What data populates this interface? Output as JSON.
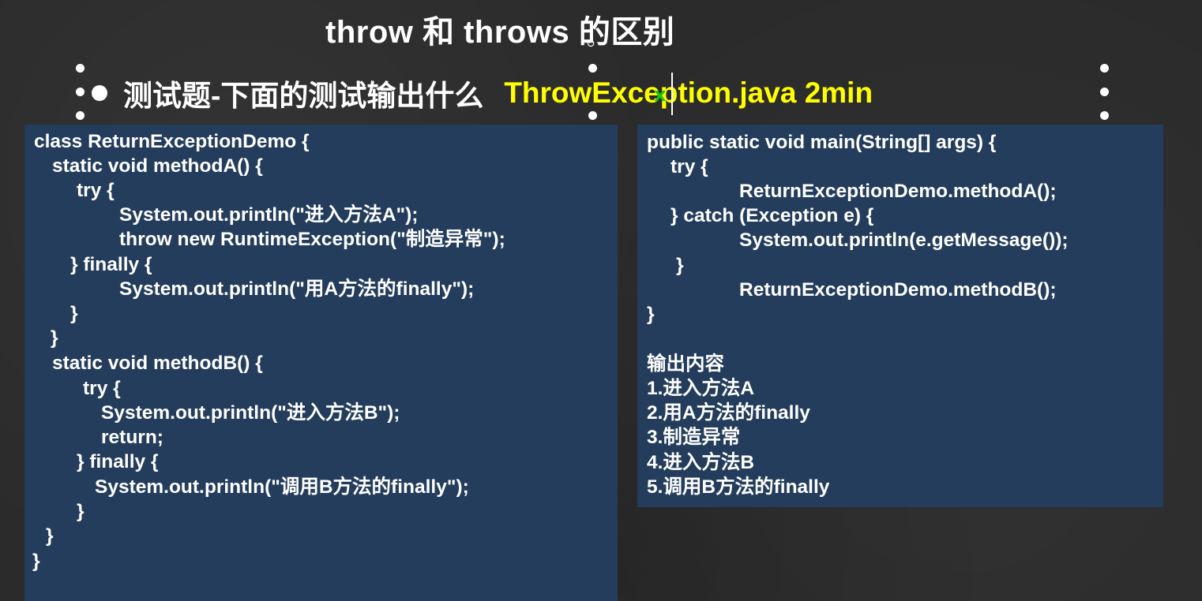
{
  "slide": {
    "title": "throw 和 throws 的区别",
    "subtitle_label": "测试题-下面的测试输出什么",
    "subtitle_highlight": "ThrowException.java 2min"
  },
  "left_code": [
    "class ReturnExceptionDemo {",
    "static void methodA() {",
    "try {",
    "System.out.println(\"进入方法A\");",
    "throw new RuntimeException(\"制造异常\");",
    "} finally {",
    "System.out.println(\"用A方法的finally\");",
    "}",
    "}",
    "static void methodB() {",
    "try {",
    "System.out.println(\"进入方法B\");",
    "return;",
    "} finally {",
    "System.out.println(\"调用B方法的finally\");",
    "}",
    "}",
    "}"
  ],
  "right_code": [
    "public static void main(String[] args) {",
    "try {",
    "ReturnExceptionDemo.methodA();",
    "} catch (Exception e) {",
    "System.out.println(e.getMessage());",
    "}",
    "ReturnExceptionDemo.methodB();",
    "}"
  ],
  "output": {
    "heading": "输出内容",
    "items": [
      "1.进入方法A",
      "2.用A方法的finally",
      "3.制造异常",
      "4.进入方法B",
      "5.调用B方法的finally"
    ]
  },
  "colors": {
    "background": "#2b2b2b",
    "panel": "#243d5d",
    "highlight": "#ffff00",
    "text": "#ffffff"
  },
  "icons": {
    "bullet": "bullet-dot-icon",
    "rotate": "rotate-handle-icon",
    "cursor": "text-cursor-icon"
  }
}
